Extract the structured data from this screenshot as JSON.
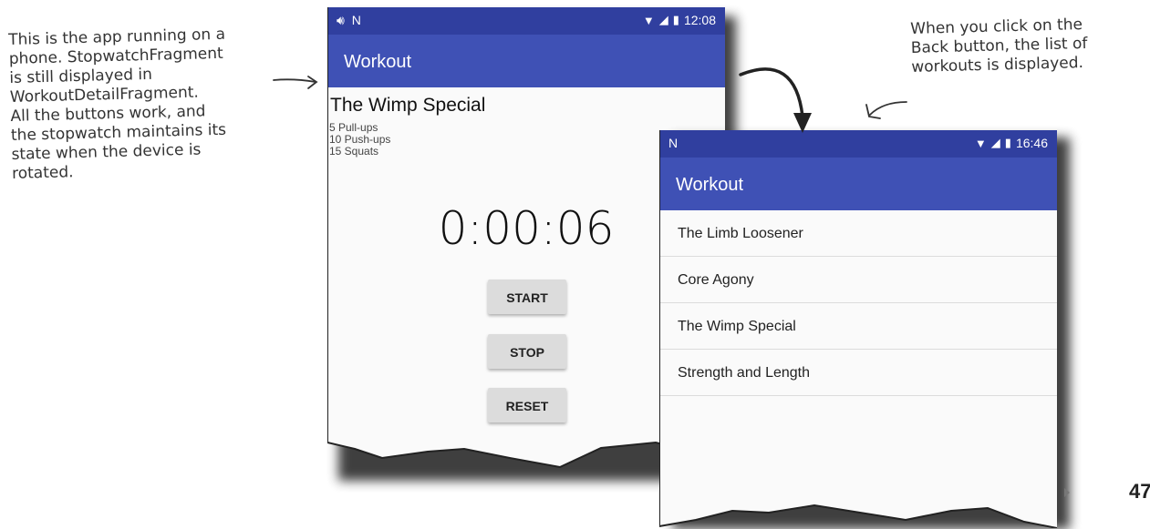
{
  "annotations": {
    "left": [
      "This is the app running on a",
      "phone. StopwatchFragment",
      "is still displayed in",
      "WorkoutDetailFragment.",
      "All the buttons work, and",
      "the stopwatch maintains its",
      "state when the device is",
      "rotated."
    ],
    "right": [
      "When you click on the",
      "Back button, the list of",
      "workouts is displayed."
    ]
  },
  "phone1": {
    "status_time": "12:08",
    "app_title": "Workout",
    "workout_title": "The Wimp Special",
    "workout_lines": [
      "5 Pull-ups",
      "10 Push-ups",
      "15 Squats"
    ],
    "timer": "0:00:06",
    "buttons": {
      "start": "START",
      "stop": "STOP",
      "reset": "RESET"
    }
  },
  "phone2": {
    "status_time": "16:46",
    "app_title": "Workout",
    "workouts": [
      "The Limb Loosener",
      "Core Agony",
      "The Wimp Special",
      "Strength and Length"
    ]
  },
  "page_number": "47",
  "colors": {
    "app_bar": "#3f51b5",
    "status_bar": "#303f9f",
    "background": "#fafafa",
    "button": "#dcdcdc"
  }
}
